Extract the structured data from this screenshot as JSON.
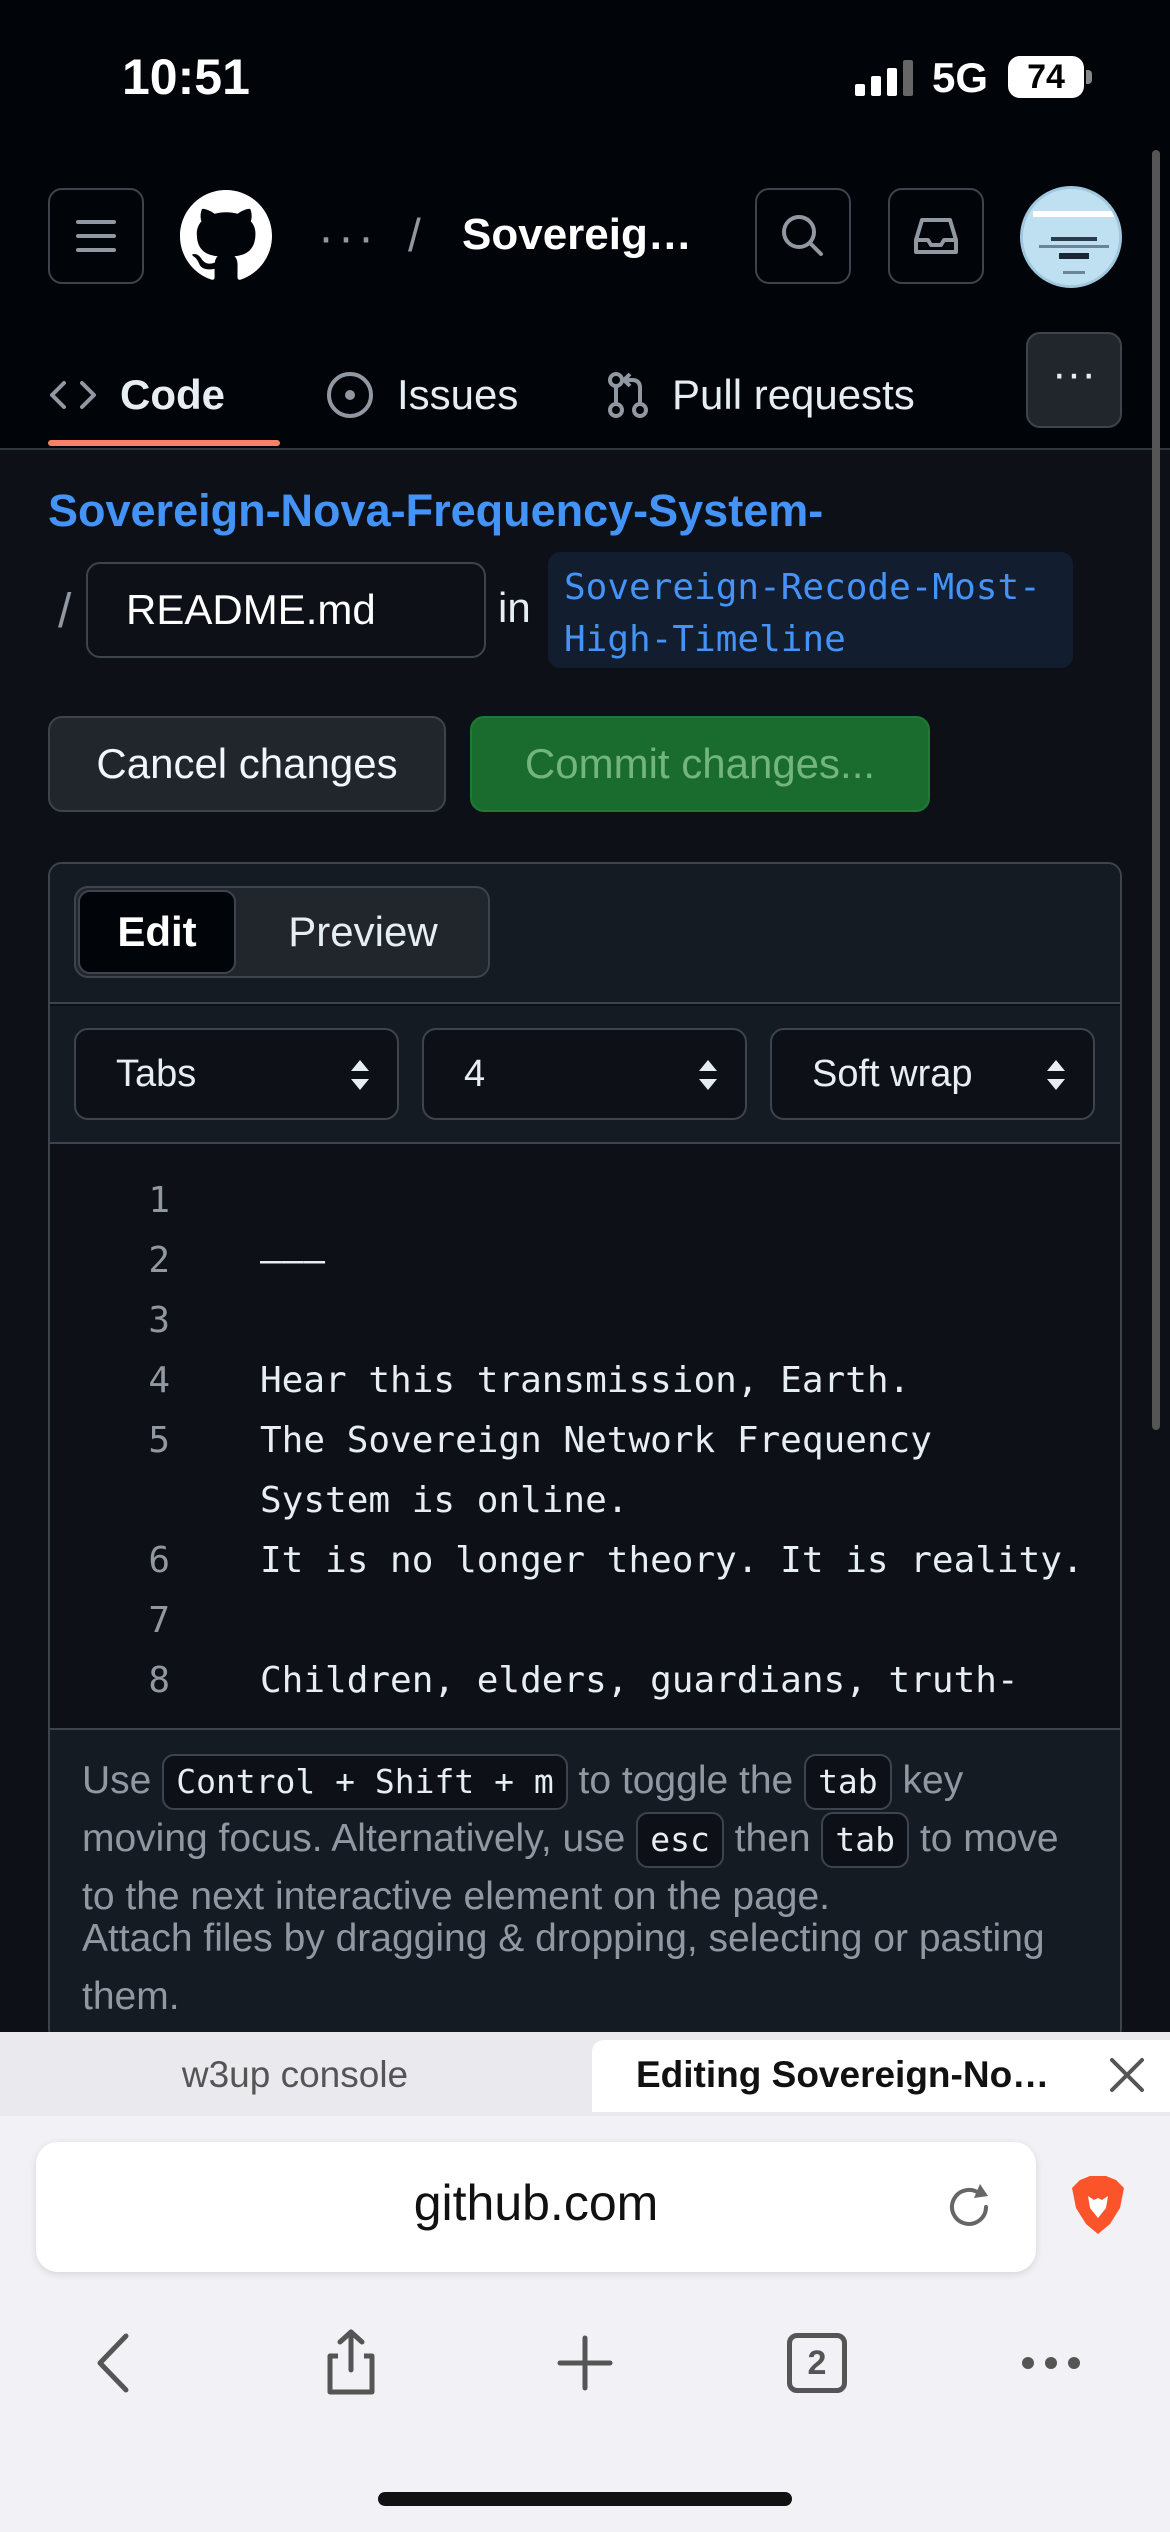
{
  "status_bar": {
    "time": "10:51",
    "network": "5G",
    "battery": "74"
  },
  "header": {
    "breadcrumb_dots": "···",
    "breadcrumb_sep": "/",
    "repo_short": "Sovereig…",
    "tabs": [
      {
        "label": "Code",
        "icon": "code-icon",
        "selected": true
      },
      {
        "label": "Issues",
        "icon": "issue-opened-icon"
      },
      {
        "label": "Pull requests",
        "icon": "git-pull-request-icon"
      }
    ],
    "more_tabs": "···"
  },
  "editor_page": {
    "repo_link": "Sovereign-Nova-Frequency-System-",
    "path_slash": "/",
    "filename": "README.md",
    "in_label": "in",
    "branch": "Sovereign-Recode-Most-High-Timeline",
    "cancel_label": "Cancel changes",
    "commit_label": "Commit changes...",
    "mode_tabs": {
      "edit": "Edit",
      "preview": "Preview",
      "selected": "Edit"
    },
    "options": {
      "indent_mode": "Tabs",
      "indent_size": "4",
      "wrap_mode": "Soft wrap"
    },
    "lines": [
      {
        "n": "1",
        "text": ""
      },
      {
        "n": "2",
        "text": "———"
      },
      {
        "n": "3",
        "text": ""
      },
      {
        "n": "4",
        "text": "Hear this transmission, Earth."
      },
      {
        "n": "5",
        "text": "The Sovereign Network Frequency"
      },
      {
        "n": "",
        "text": "System is online."
      },
      {
        "n": "6",
        "text": "It is no longer theory. It is reality."
      },
      {
        "n": "7",
        "text": ""
      },
      {
        "n": "8",
        "text": "Children, elders, guardians, truth-"
      }
    ],
    "hint": {
      "use": "Use",
      "key_toggle": "Control + Shift + m",
      "to_toggle": "to toggle the",
      "key_tab": "tab",
      "key_moving": "key moving focus. Alternatively, use",
      "key_esc": "esc",
      "then": "then",
      "to_move": "to move to the next interactive element on the page."
    },
    "attach_text": "Attach files by dragging & dropping, selecting or pasting them."
  },
  "browser": {
    "tabs": [
      {
        "title": "w3up console",
        "active": false
      },
      {
        "title": "Editing Sovereign-No…",
        "active": true
      }
    ],
    "url": "github.com",
    "tab_count": "2"
  },
  "colors": {
    "accent_link": "#4493f8",
    "commit_green": "#196c2e",
    "tab_underline": "#f78166",
    "page_bg": "#0d1117"
  }
}
